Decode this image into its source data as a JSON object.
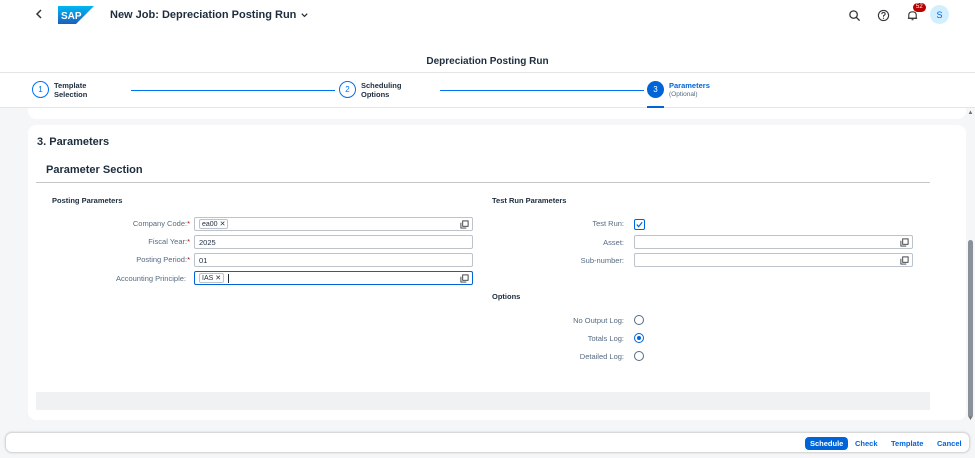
{
  "shell": {
    "title": "New Job: Depreciation Posting Run",
    "logo_text": "SAP",
    "notification_count": "52",
    "avatar_initial": "S"
  },
  "page": {
    "title": "Depreciation Posting Run"
  },
  "wizard": {
    "steps": [
      {
        "number": "1",
        "label_line1": "Template",
        "label_line2": "Selection"
      },
      {
        "number": "2",
        "label_line1": "Scheduling",
        "label_line2": "Options"
      },
      {
        "number": "3",
        "label_line1": "Parameters",
        "label_line2": "(Optional)"
      }
    ]
  },
  "section": {
    "title": "3. Parameters",
    "subtitle": "Parameter Section"
  },
  "posting": {
    "header": "Posting Parameters",
    "company_code_label": "Company Code:",
    "company_code_token": "ea00",
    "fiscal_year_label": "Fiscal Year:",
    "fiscal_year_value": "2025",
    "posting_period_label": "Posting Period:",
    "posting_period_value": "01",
    "accounting_principle_label": "Accounting Principle:",
    "accounting_principle_token": "IAS",
    "required_mark": "*"
  },
  "testrun": {
    "header": "Test Run Parameters",
    "test_run_label": "Test Run:",
    "test_run_checked": true,
    "asset_label": "Asset:",
    "asset_value": "",
    "subnumber_label": "Sub-number:",
    "subnumber_value": ""
  },
  "options": {
    "header": "Options",
    "no_output_label": "No Output Log:",
    "totals_label": "Totals Log:",
    "detailed_label": "Detailed Log:",
    "selected": "totals"
  },
  "footer": {
    "schedule": "Schedule",
    "check": "Check",
    "template": "Template",
    "cancel": "Cancel"
  },
  "colors": {
    "accent": "#0064d9",
    "badge": "#bb0000",
    "required": "#aa0808"
  }
}
